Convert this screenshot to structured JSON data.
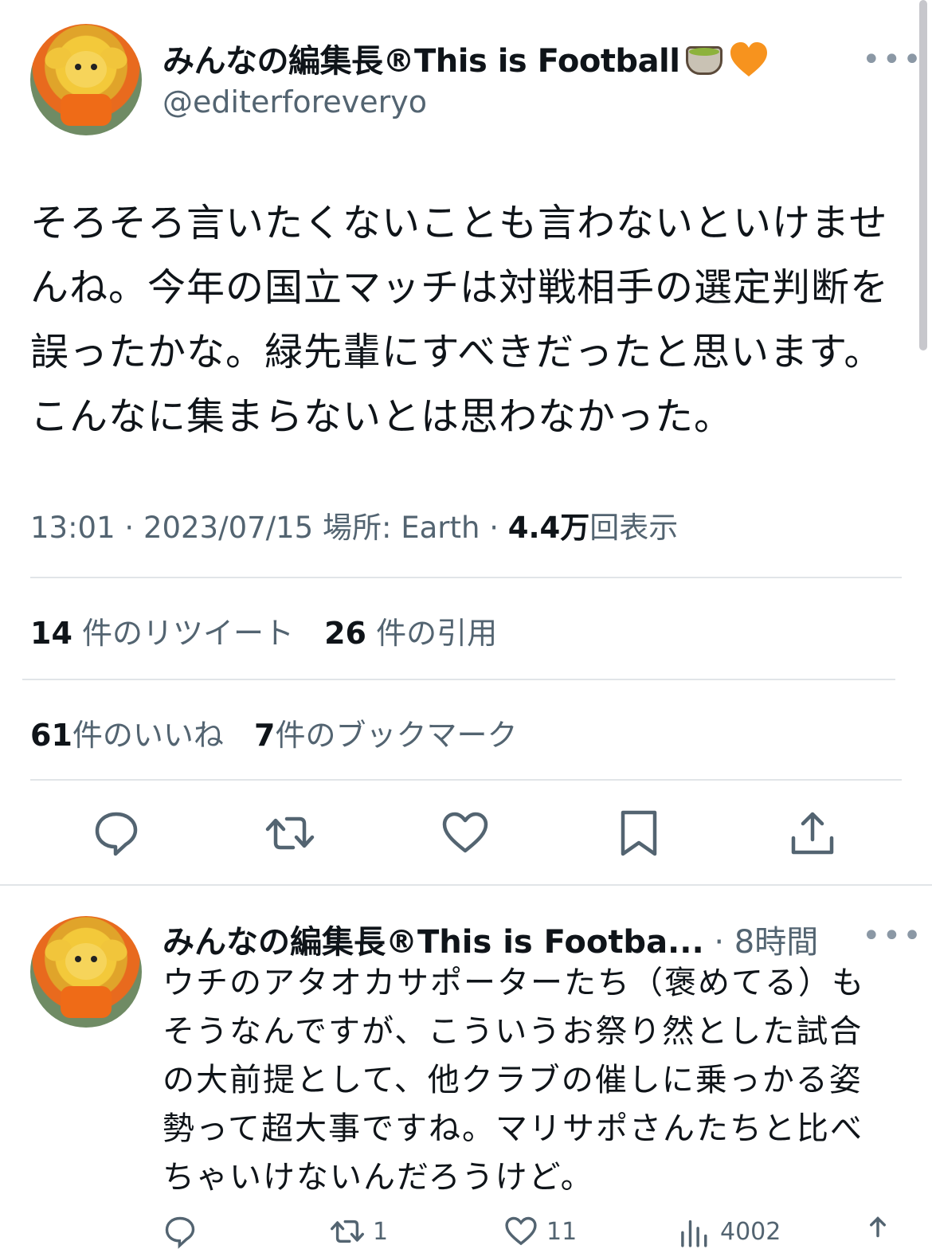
{
  "colors": {
    "text": "#0f1419",
    "secondary": "#536471",
    "divider": "#e1e5e8",
    "heart_emoji": "#f7931e"
  },
  "tweet": {
    "display_name": "みんなの編集長®This is Football",
    "emoji_icons": [
      "tea-icon",
      "orange-heart-icon"
    ],
    "handle": "@editerforeveryo",
    "more_label": "•••",
    "text_lines": [
      "そろそろ言いたくないことも言わないといけませ",
      "んね。今年の国立マッチは対戦相手の選定判断を",
      "誤ったかな。緑先輩にすべきだったと思います。",
      "こんなに集まらないとは思わなかった。"
    ],
    "time": "13:01",
    "date": "2023/07/15",
    "location": "場所: Earth",
    "views_count": "4.4万",
    "views_label": "回表示",
    "separator": "·"
  },
  "stats": {
    "retweets": {
      "count": "14",
      "label": "件のリツイート"
    },
    "quotes": {
      "count": "26",
      "label": "件の引用"
    },
    "likes": {
      "count": "61",
      "label": "件のいいね"
    },
    "bookmarks": {
      "count": "7",
      "label": "件のブックマーク"
    }
  },
  "actions": [
    "reply-icon",
    "retweet-icon",
    "like-icon",
    "bookmark-icon",
    "share-icon"
  ],
  "reply": {
    "display_name": "みんなの編集長®This is Footba...",
    "time": "· 8時間",
    "more_label": "•••",
    "text_lines": [
      "ウチのアタオカサポーターたち（褒めてる）も",
      "そうなんですが、こういうお祭り然とした試合",
      "の大前提として、他クラブの催しに乗っかる姿",
      "勢って超大事ですね。マリサポさんたちと比べ",
      "ちゃいけないんだろうけど。"
    ],
    "retweet_count": "1",
    "like_count": "11",
    "view_count": "4002"
  }
}
